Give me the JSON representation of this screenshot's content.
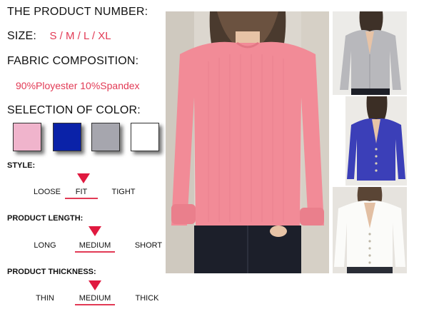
{
  "headings": {
    "product_number": "THE PRODUCT NUMBER:",
    "size": "SIZE:",
    "fabric": "FABRIC COMPOSITION:",
    "color": "SELECTION OF COLOR:"
  },
  "size_value": "S / M / L / XL",
  "fabric_value": "90%Ployester 10%Spandex",
  "colors": [
    "#f0b4cc",
    "#0a22a8",
    "#a6a6ae",
    "#ffffff"
  ],
  "style": {
    "label": "STYLE:",
    "options": [
      "LOOSE",
      "FIT",
      "TIGHT"
    ],
    "selected": "FIT"
  },
  "length": {
    "label": "PRODUCT LENGTH:",
    "options": [
      "LONG",
      "MEDIUM",
      "SHORT"
    ],
    "selected": "MEDIUM"
  },
  "thickness": {
    "label": "PRODUCT THICKNESS:",
    "options": [
      "THIN",
      "MEDIUM",
      "THICK"
    ],
    "selected": "MEDIUM"
  },
  "accent_color": "#e0193f"
}
